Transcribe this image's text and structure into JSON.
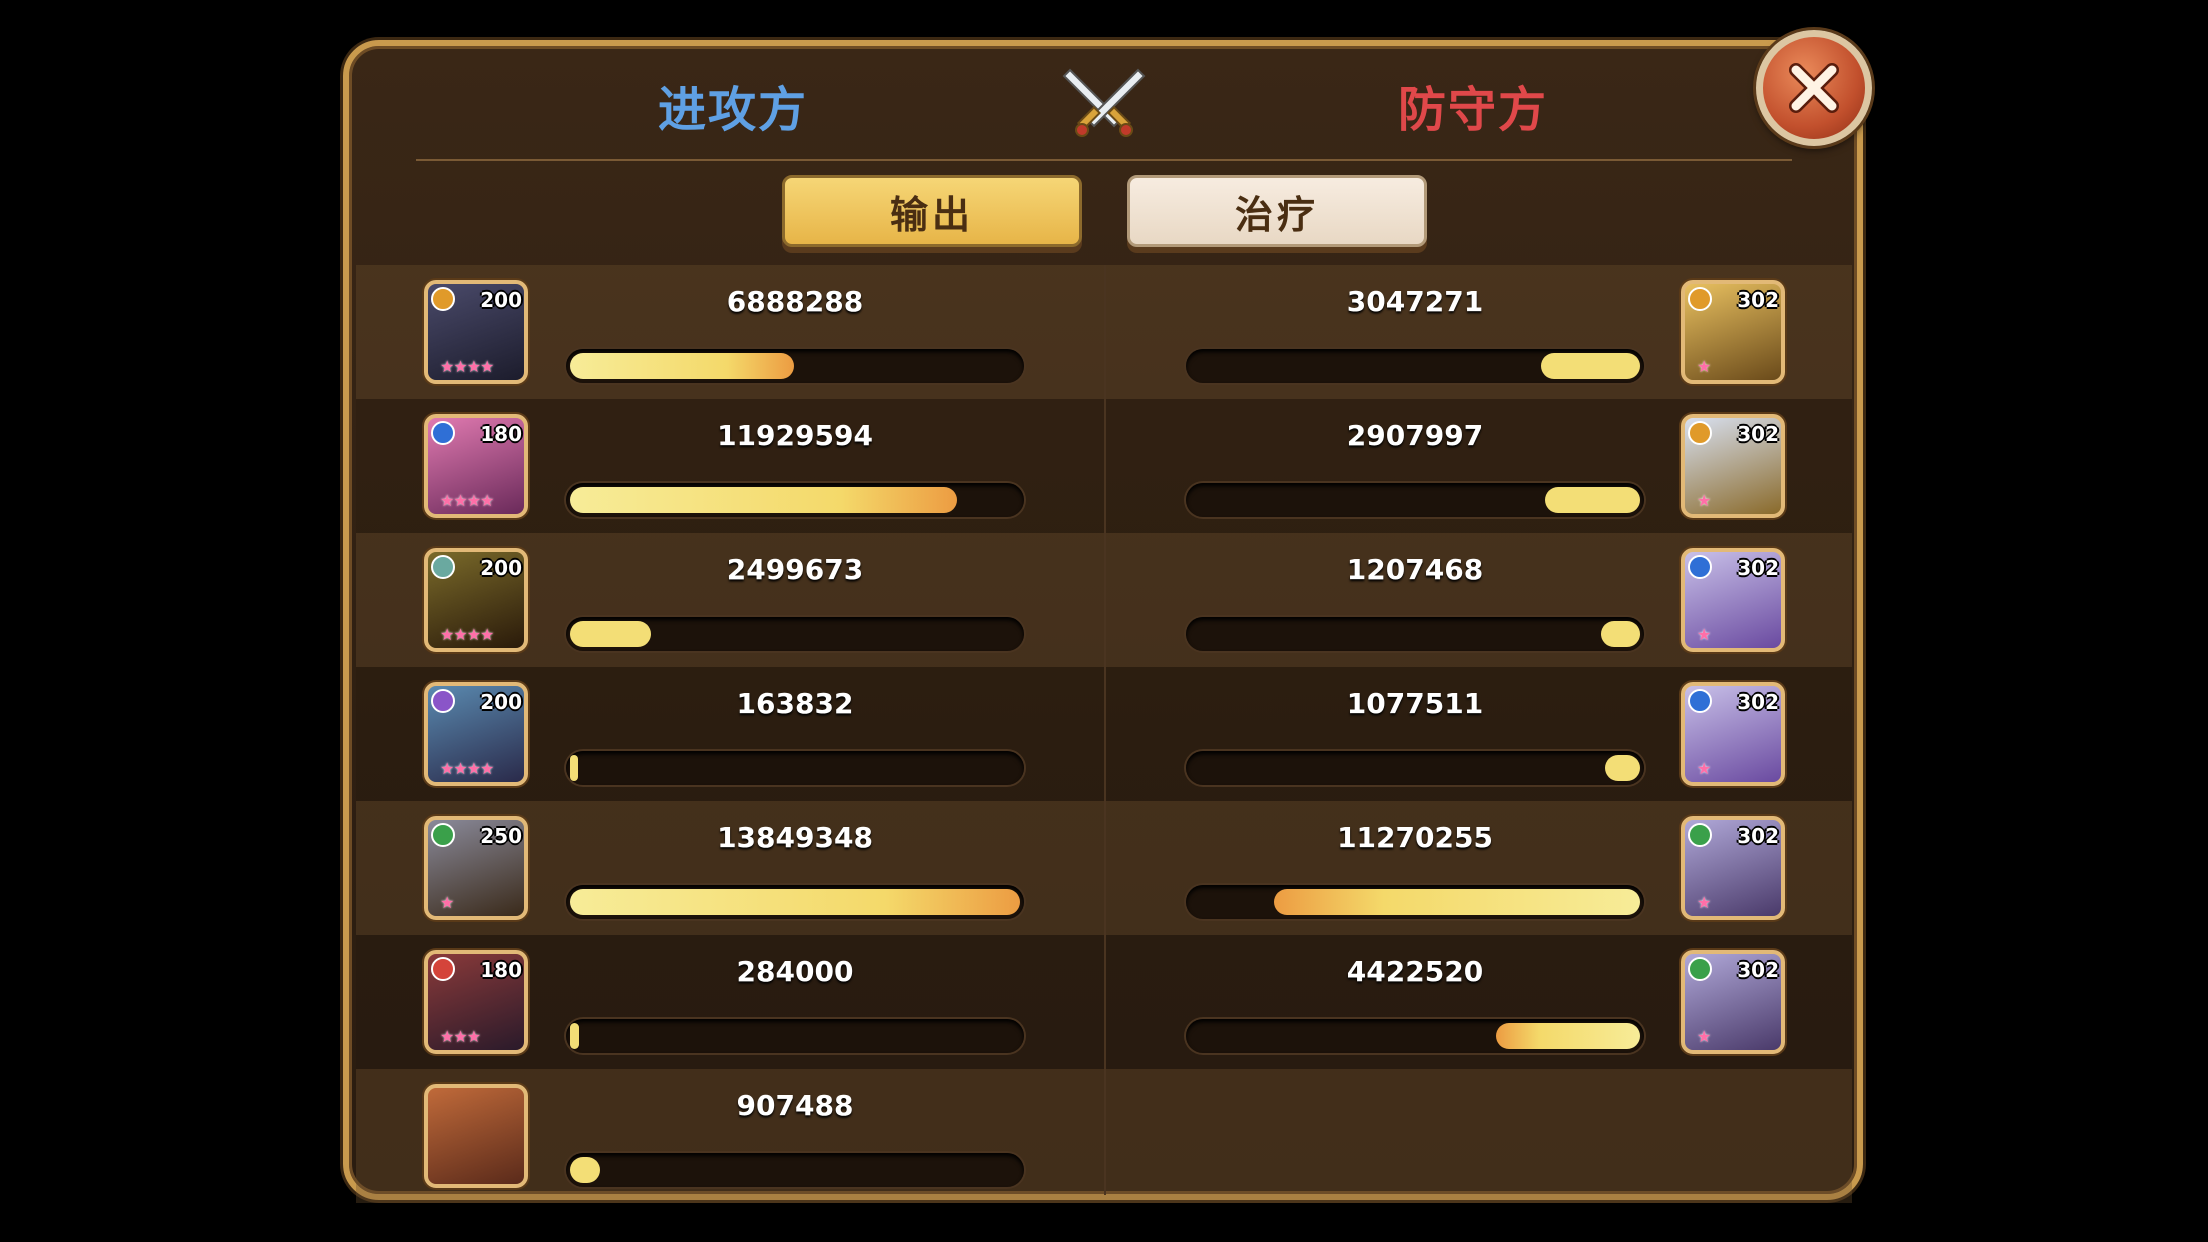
{
  "header": {
    "attacker_label": "进攻方",
    "defender_label": "防守方"
  },
  "tabs": [
    {
      "label": "输出",
      "selected": true
    },
    {
      "label": "治疗",
      "selected": false
    }
  ],
  "colors": {
    "attacker": "#5fa0e4",
    "defender": "#e0484a",
    "bar_fill": "#f4d96a",
    "tab_selected": "#e7b548"
  },
  "attackers": [
    {
      "level": "200",
      "element": "gold-element-icon",
      "stars": "★★★★",
      "value": "6888288",
      "fraction": 0.497
    },
    {
      "level": "180",
      "element": "blue-element-icon",
      "stars": "★★★★",
      "value": "11929594",
      "fraction": 0.861
    },
    {
      "level": "200",
      "element": "skull-element-icon",
      "stars": "★★★★",
      "value": "2499673",
      "fraction": 0.18
    },
    {
      "level": "200",
      "element": "purple-element-icon",
      "stars": "★★★★",
      "value": "163832",
      "fraction": 0.012
    },
    {
      "level": "250",
      "element": "green-element-icon",
      "stars": "★",
      "value": "13849348",
      "fraction": 1.0
    },
    {
      "level": "180",
      "element": "red-element-icon",
      "stars": "★★★",
      "value": "284000",
      "fraction": 0.021
    },
    {
      "level": "",
      "element": "",
      "stars": "",
      "value": "907488",
      "fraction": 0.066
    }
  ],
  "defenders": [
    {
      "level": "302",
      "element": "gold-element-icon",
      "stars": "★",
      "value": "3047271",
      "fraction": 0.22
    },
    {
      "level": "302",
      "element": "gold-element-icon",
      "stars": "★",
      "value": "2907997",
      "fraction": 0.21
    },
    {
      "level": "302",
      "element": "blue-element-icon",
      "stars": "★",
      "value": "1207468",
      "fraction": 0.087
    },
    {
      "level": "302",
      "element": "blue-element-icon",
      "stars": "★",
      "value": "1077511",
      "fraction": 0.078
    },
    {
      "level": "302",
      "element": "green-element-icon",
      "stars": "★",
      "value": "11270255",
      "fraction": 0.814
    },
    {
      "level": "302",
      "element": "green-element-icon",
      "stars": "★",
      "value": "4422520",
      "fraction": 0.319
    }
  ]
}
